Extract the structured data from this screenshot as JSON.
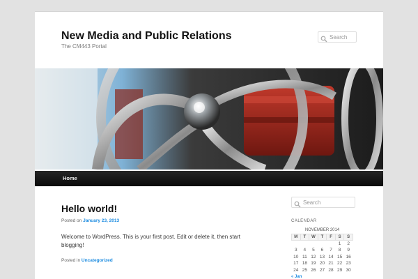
{
  "site": {
    "title": "New Media and Public Relations",
    "description": "The CM443 Portal"
  },
  "header_search": {
    "placeholder": "Search"
  },
  "nav": {
    "items": [
      {
        "label": "Home"
      }
    ]
  },
  "post": {
    "title": "Hello world!",
    "posted_on": "Posted on",
    "date": "January 23, 2013",
    "body": "Welcome to WordPress. This is your first post. Edit or delete it, then start blogging!",
    "posted_in": "Posted in",
    "category": "Uncategorized"
  },
  "sidebar": {
    "search": {
      "placeholder": "Search"
    },
    "calendar": {
      "title": "CALENDAR",
      "caption": "NOVEMBER 2014",
      "headers": [
        "M",
        "T",
        "W",
        "T",
        "F",
        "S",
        "S"
      ],
      "rows": [
        [
          "",
          "",
          "",
          "",
          "",
          "1",
          "2"
        ],
        [
          "3",
          "4",
          "5",
          "6",
          "7",
          "8",
          "9"
        ],
        [
          "10",
          "11",
          "12",
          "13",
          "14",
          "15",
          "16"
        ],
        [
          "17",
          "18",
          "19",
          "20",
          "21",
          "22",
          "23"
        ],
        [
          "24",
          "25",
          "26",
          "27",
          "28",
          "29",
          "30"
        ]
      ],
      "prev_link": "« Jan"
    }
  },
  "colors": {
    "background": "#e2e2e2",
    "nav_bar": "#1a1a1a",
    "link": "#1b8be0"
  },
  "icons": {
    "search": "magnifier-icon"
  }
}
